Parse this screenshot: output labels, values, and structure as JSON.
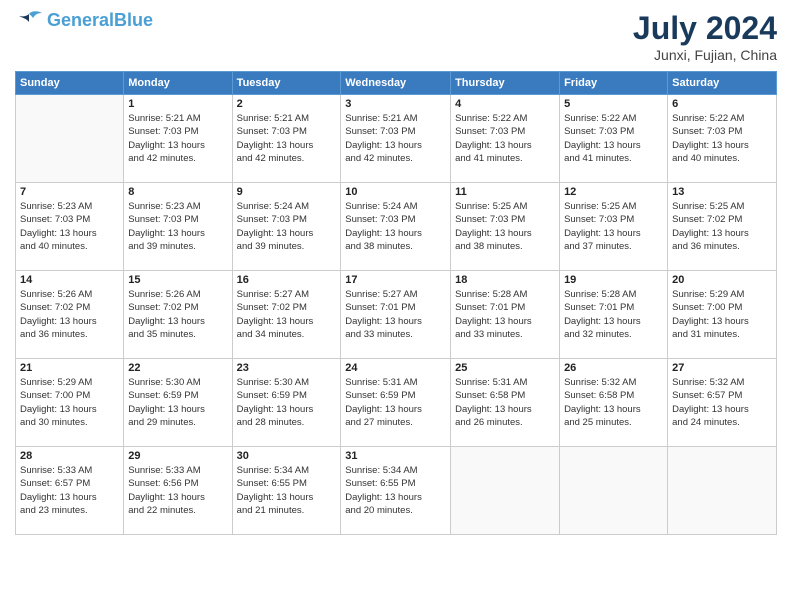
{
  "header": {
    "logo_line1": "General",
    "logo_line2": "Blue",
    "month_title": "July 2024",
    "location": "Junxi, Fujian, China"
  },
  "weekdays": [
    "Sunday",
    "Monday",
    "Tuesday",
    "Wednesday",
    "Thursday",
    "Friday",
    "Saturday"
  ],
  "weeks": [
    [
      {
        "day": "",
        "info": ""
      },
      {
        "day": "1",
        "info": "Sunrise: 5:21 AM\nSunset: 7:03 PM\nDaylight: 13 hours\nand 42 minutes."
      },
      {
        "day": "2",
        "info": "Sunrise: 5:21 AM\nSunset: 7:03 PM\nDaylight: 13 hours\nand 42 minutes."
      },
      {
        "day": "3",
        "info": "Sunrise: 5:21 AM\nSunset: 7:03 PM\nDaylight: 13 hours\nand 42 minutes."
      },
      {
        "day": "4",
        "info": "Sunrise: 5:22 AM\nSunset: 7:03 PM\nDaylight: 13 hours\nand 41 minutes."
      },
      {
        "day": "5",
        "info": "Sunrise: 5:22 AM\nSunset: 7:03 PM\nDaylight: 13 hours\nand 41 minutes."
      },
      {
        "day": "6",
        "info": "Sunrise: 5:22 AM\nSunset: 7:03 PM\nDaylight: 13 hours\nand 40 minutes."
      }
    ],
    [
      {
        "day": "7",
        "info": "Sunrise: 5:23 AM\nSunset: 7:03 PM\nDaylight: 13 hours\nand 40 minutes."
      },
      {
        "day": "8",
        "info": "Sunrise: 5:23 AM\nSunset: 7:03 PM\nDaylight: 13 hours\nand 39 minutes."
      },
      {
        "day": "9",
        "info": "Sunrise: 5:24 AM\nSunset: 7:03 PM\nDaylight: 13 hours\nand 39 minutes."
      },
      {
        "day": "10",
        "info": "Sunrise: 5:24 AM\nSunset: 7:03 PM\nDaylight: 13 hours\nand 38 minutes."
      },
      {
        "day": "11",
        "info": "Sunrise: 5:25 AM\nSunset: 7:03 PM\nDaylight: 13 hours\nand 38 minutes."
      },
      {
        "day": "12",
        "info": "Sunrise: 5:25 AM\nSunset: 7:03 PM\nDaylight: 13 hours\nand 37 minutes."
      },
      {
        "day": "13",
        "info": "Sunrise: 5:25 AM\nSunset: 7:02 PM\nDaylight: 13 hours\nand 36 minutes."
      }
    ],
    [
      {
        "day": "14",
        "info": "Sunrise: 5:26 AM\nSunset: 7:02 PM\nDaylight: 13 hours\nand 36 minutes."
      },
      {
        "day": "15",
        "info": "Sunrise: 5:26 AM\nSunset: 7:02 PM\nDaylight: 13 hours\nand 35 minutes."
      },
      {
        "day": "16",
        "info": "Sunrise: 5:27 AM\nSunset: 7:02 PM\nDaylight: 13 hours\nand 34 minutes."
      },
      {
        "day": "17",
        "info": "Sunrise: 5:27 AM\nSunset: 7:01 PM\nDaylight: 13 hours\nand 33 minutes."
      },
      {
        "day": "18",
        "info": "Sunrise: 5:28 AM\nSunset: 7:01 PM\nDaylight: 13 hours\nand 33 minutes."
      },
      {
        "day": "19",
        "info": "Sunrise: 5:28 AM\nSunset: 7:01 PM\nDaylight: 13 hours\nand 32 minutes."
      },
      {
        "day": "20",
        "info": "Sunrise: 5:29 AM\nSunset: 7:00 PM\nDaylight: 13 hours\nand 31 minutes."
      }
    ],
    [
      {
        "day": "21",
        "info": "Sunrise: 5:29 AM\nSunset: 7:00 PM\nDaylight: 13 hours\nand 30 minutes."
      },
      {
        "day": "22",
        "info": "Sunrise: 5:30 AM\nSunset: 6:59 PM\nDaylight: 13 hours\nand 29 minutes."
      },
      {
        "day": "23",
        "info": "Sunrise: 5:30 AM\nSunset: 6:59 PM\nDaylight: 13 hours\nand 28 minutes."
      },
      {
        "day": "24",
        "info": "Sunrise: 5:31 AM\nSunset: 6:59 PM\nDaylight: 13 hours\nand 27 minutes."
      },
      {
        "day": "25",
        "info": "Sunrise: 5:31 AM\nSunset: 6:58 PM\nDaylight: 13 hours\nand 26 minutes."
      },
      {
        "day": "26",
        "info": "Sunrise: 5:32 AM\nSunset: 6:58 PM\nDaylight: 13 hours\nand 25 minutes."
      },
      {
        "day": "27",
        "info": "Sunrise: 5:32 AM\nSunset: 6:57 PM\nDaylight: 13 hours\nand 24 minutes."
      }
    ],
    [
      {
        "day": "28",
        "info": "Sunrise: 5:33 AM\nSunset: 6:57 PM\nDaylight: 13 hours\nand 23 minutes."
      },
      {
        "day": "29",
        "info": "Sunrise: 5:33 AM\nSunset: 6:56 PM\nDaylight: 13 hours\nand 22 minutes."
      },
      {
        "day": "30",
        "info": "Sunrise: 5:34 AM\nSunset: 6:55 PM\nDaylight: 13 hours\nand 21 minutes."
      },
      {
        "day": "31",
        "info": "Sunrise: 5:34 AM\nSunset: 6:55 PM\nDaylight: 13 hours\nand 20 minutes."
      },
      {
        "day": "",
        "info": ""
      },
      {
        "day": "",
        "info": ""
      },
      {
        "day": "",
        "info": ""
      }
    ]
  ]
}
